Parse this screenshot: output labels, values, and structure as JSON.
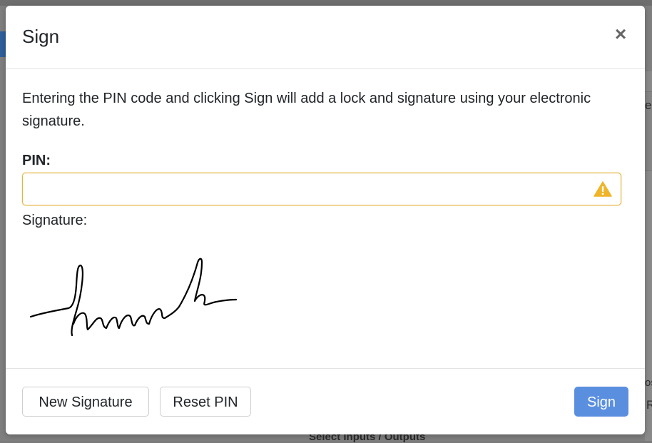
{
  "background": {
    "peek_right_top": "e",
    "peek_right_bottom_1": "os",
    "peek_right_bottom_2": "R",
    "bottom_text": "Select Inputs / Outputs"
  },
  "modal": {
    "title": "Sign",
    "close_icon": "close-icon",
    "intro_text": "Entering the PIN code and clicking Sign will add a lock and signature using your electronic signature.",
    "pin": {
      "label": "PIN:",
      "value": "",
      "placeholder": "",
      "warning_icon": "warning-icon",
      "warning_color": "#f0b429"
    },
    "signature": {
      "label": "Signature:",
      "image": "handwritten-signature"
    },
    "footer": {
      "new_signature_label": "New Signature",
      "reset_pin_label": "Reset PIN",
      "sign_label": "Sign",
      "primary_color": "#5a8fe0"
    }
  }
}
